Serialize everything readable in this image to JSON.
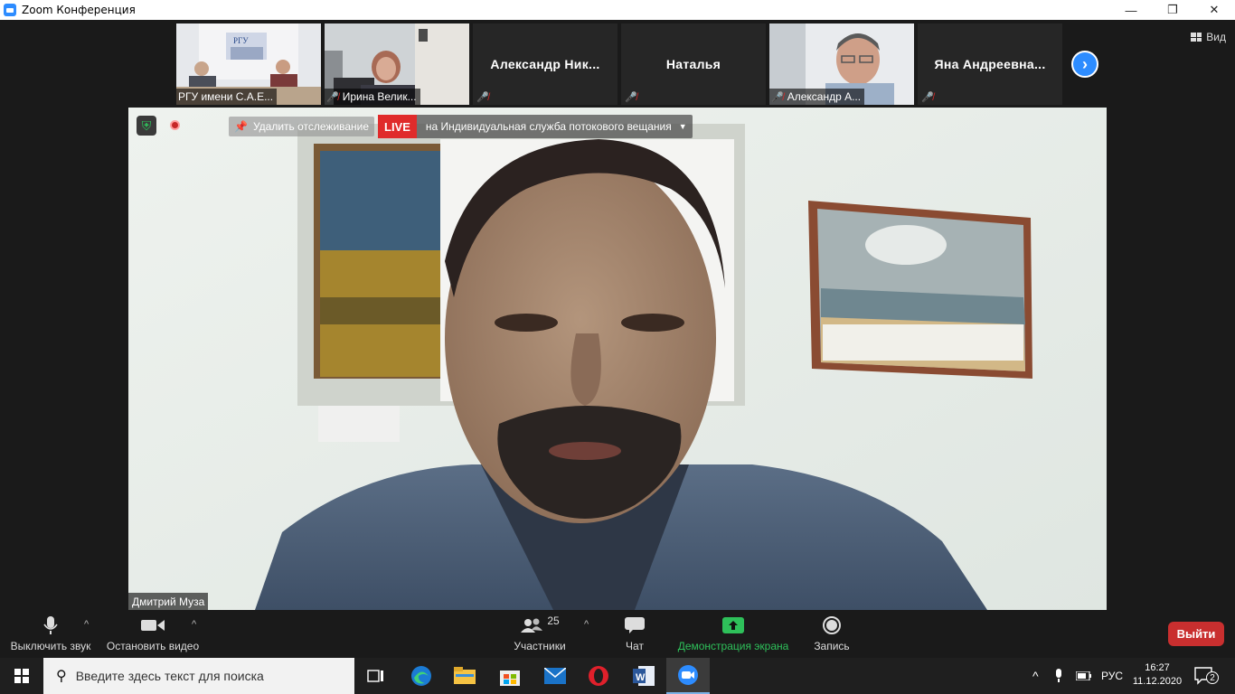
{
  "window": {
    "title": "Zoom Конференция",
    "controls": [
      "—",
      "❐",
      "✕"
    ]
  },
  "gallery": {
    "tiles": [
      {
        "name": "РГУ имени С.А.Е...",
        "type": "video",
        "muted": false
      },
      {
        "name": "Ирина Велик...",
        "type": "video",
        "muted": true
      },
      {
        "name": "Александр  Ник...",
        "type": "name",
        "muted": true
      },
      {
        "name": "Наталья",
        "type": "name",
        "muted": true
      },
      {
        "name": "Александр А...",
        "type": "video",
        "muted": true
      },
      {
        "name": "Яна  Андреевна...",
        "type": "name",
        "muted": true
      }
    ],
    "next_icon": "chevron-right-icon",
    "view_label": "Вид"
  },
  "main_video": {
    "speaker_name": "Дмитрий Муза",
    "tracking_label": "Удалить отслеживание",
    "live_badge": "LIVE",
    "live_text": "на Индивидуальная служба потокового вещания"
  },
  "toolbar": {
    "mute_label": "Выключить звук",
    "video_label": "Остановить видео",
    "participants_label": "Участники",
    "participants_count": "25",
    "chat_label": "Чат",
    "share_label": "Демонстрация экрана",
    "record_label": "Запись",
    "leave_label": "Выйти"
  },
  "taskbar": {
    "search_placeholder": "Введите здесь текст для поиска",
    "language": "РУС",
    "time": "16:27",
    "date": "11.12.2020",
    "notifications": "2"
  },
  "colors": {
    "accent": "#2d8cff",
    "live": "#e02b2b",
    "share_green": "#2ec05a",
    "leave": "#c92f2f"
  }
}
